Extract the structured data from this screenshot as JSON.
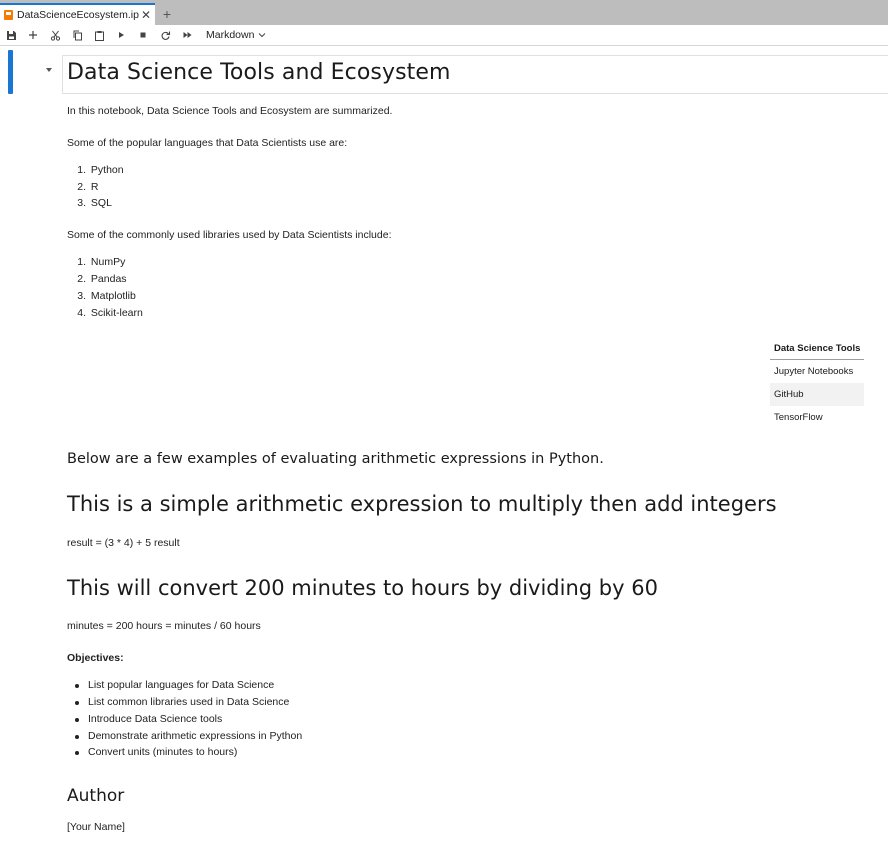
{
  "tab": {
    "label": "DataScienceEcosystem.ipynb",
    "close": "✕",
    "add": "+"
  },
  "toolbar": {
    "cell_type": "Markdown"
  },
  "notebook": {
    "title": "Data Science Tools and Ecosystem",
    "intro": "In this notebook, Data Science Tools and Ecosystem are summarized.",
    "languages_intro": "Some of the popular languages that Data Scientists use are:",
    "languages": [
      "Python",
      "R",
      "SQL"
    ],
    "libraries_intro": "Some of the commonly used libraries used by Data Scientists include:",
    "libraries": [
      "NumPy",
      "Pandas",
      "Matplotlib",
      "Scikit-learn"
    ],
    "tools_table": {
      "header": "Data Science Tools",
      "rows": [
        "Jupyter Notebooks",
        "GitHub",
        "TensorFlow"
      ]
    },
    "arith_intro": "Below are a few examples of evaluating arithmetic expressions in Python.",
    "multiply_heading": "This is a simple arithmetic expression to multiply then add integers",
    "multiply_code": "result = (3 * 4) + 5 result",
    "convert_heading": "This will convert 200 minutes to hours by dividing by 60",
    "convert_code": "minutes = 200 hours = minutes / 60 hours",
    "objectives_label": "Objectives:",
    "objectives": [
      "List popular languages for Data Science",
      "List common libraries used in Data Science",
      "Introduce Data Science tools",
      "Demonstrate arithmetic expressions in Python",
      "Convert units (minutes to hours)"
    ],
    "author_heading": "Author",
    "author_name": "[Your Name]"
  },
  "list_numbers": [
    "1.",
    "2.",
    "3.",
    "4."
  ],
  "colors": {
    "accent": "#1976d2",
    "tab_icon": "#f57c00",
    "tabbar_bg": "#bdbdbd"
  }
}
